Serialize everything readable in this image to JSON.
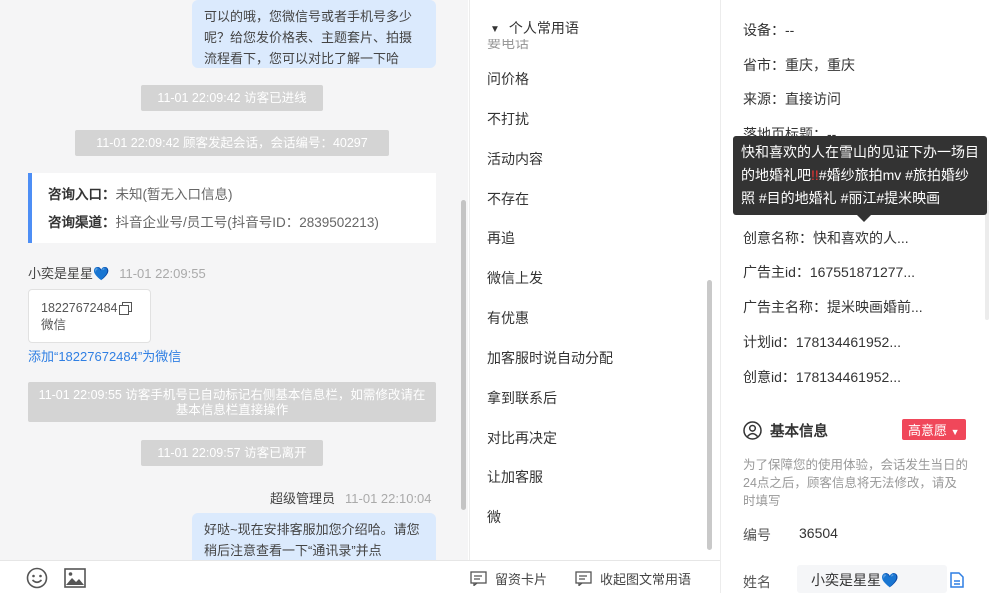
{
  "chat": {
    "msg_top": "可以的哦，您微信号或者手机号多少呢？给您发价格表、主题套片、拍摄流程看下，您可以对比了解一下哈",
    "sys_enter": "11-01 22:09:42 访客已进线",
    "sys_session": "11-01 22:09:42 顾客发起会话，会话编号：40297",
    "entry": {
      "label1": "咨询入口：",
      "value1": "未知(暂无入口信息)",
      "label2": "咨询渠道：",
      "value2": "抖音企业号/员工号(抖音号ID：2839502213)"
    },
    "visitor_name": "小奕是星星",
    "visitor_time": "11-01 22:09:55",
    "phone_card": {
      "number": "18227672484",
      "type": "微信"
    },
    "add_wechat": "添加“18227672484”为微信",
    "sys_phone_marked": "11-01 22:09:55 访客手机号已自动标记右侧基本信息栏，如需修改请在基本信息栏直接操作",
    "sys_leave": "11-01 22:09:57 访客已离开",
    "admin_name": "超级管理员",
    "admin_time": "11-01 22:10:04",
    "msg_bottom": "好哒~现在安排客服加您介绍哈。请您稍后注意查看一下“通讯录”并点"
  },
  "composer": {
    "emoji_icon": "smile-icon",
    "image_icon": "image-icon",
    "leave_card": "留资卡片",
    "collapse_phrases": "收起图文常用语"
  },
  "phrases": {
    "header": "个人常用语",
    "items": [
      "问价格",
      "不打扰",
      "活动内容",
      "不存在",
      "再追",
      "微信上发",
      "有优惠",
      "加客服时说自动分配",
      "拿到联系后",
      "对比再决定",
      "让加客服",
      "微"
    ]
  },
  "side": {
    "device": "设备：--",
    "province": "省市：重庆，重庆",
    "source": "来源：直接访问",
    "landing": "落地页标题：--",
    "creative_name": "创意名称：快和喜欢的人...",
    "advertiser_id": "广告主id：167551871277...",
    "advertiser_name": "广告主名称：提米映画婚前...",
    "plan_id": "计划id：178134461952...",
    "creative_id": "创意id：178134461952...",
    "tooltip_a": "快和喜欢的人在雪山的见证下办一场目的地婚礼吧",
    "tooltip_bang": "!!",
    "tooltip_b": "#婚纱旅拍mv #旅拍婚纱照 #目的地婚礼 #丽江#提米映画",
    "basic_title": "基本信息",
    "intent_badge": "高意愿",
    "notice": "为了保障您的使用体验，会话发生当日的24点之后，顾客信息将无法修改，请及时填写",
    "id_label": "编号",
    "id_value": "36504",
    "name_label": "姓名",
    "name_value": "小奕是星星"
  },
  "colors": {
    "accent": "#4d8ef5",
    "link": "#2f7fe3",
    "intent": "#f0475a",
    "bubble": "#dbeafd"
  }
}
